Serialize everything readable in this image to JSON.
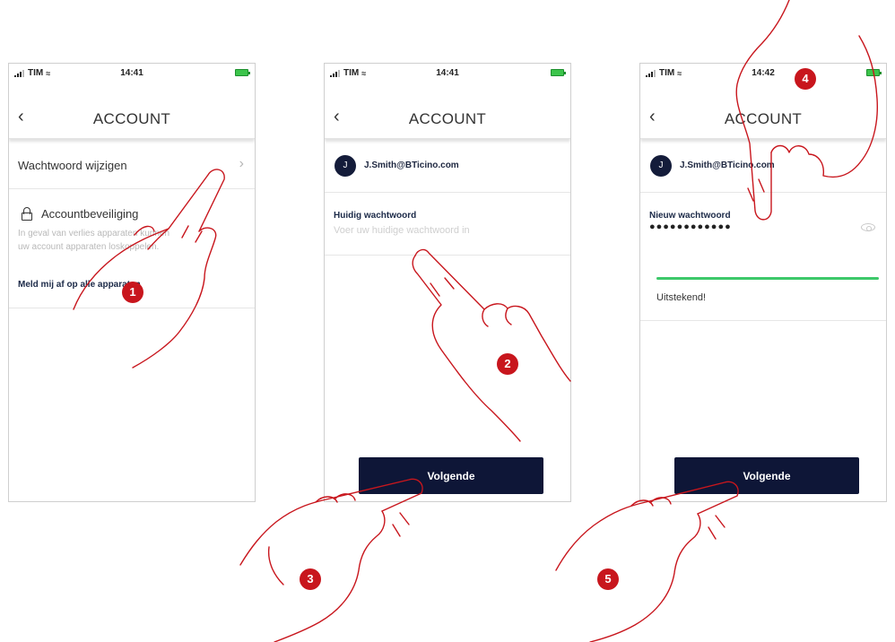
{
  "status_bar": {
    "carrier": "TIM",
    "time_screen1": "14:41",
    "time_screen2": "14:41",
    "time_screen3": "14:42"
  },
  "nav": {
    "title": "ACCOUNT",
    "back_glyph": "‹"
  },
  "screen1": {
    "change_password_label": "Wachtwoord wijzigen",
    "chevron_glyph": "›",
    "security_title": "Accountbeveiliging",
    "security_desc": "In geval van verlies apparaten kunnen uw account apparaten loskoppelen.",
    "logout_all_label": "Meld mij af op alle apparaten"
  },
  "screen2": {
    "avatar_initial": "J",
    "email": "J.Smith@BTicino.com",
    "field_label": "Huidig wachtwoord",
    "field_placeholder": "Voer uw huidige wachtwoord in",
    "next_label": "Volgende"
  },
  "screen3": {
    "avatar_initial": "J",
    "email": "J.Smith@BTicino.com",
    "field_label": "Nieuw wachtwoord",
    "field_value": "●●●●●●●●●●●●",
    "strength_label": "Uitstekend!",
    "next_label": "Volgende"
  },
  "markers": [
    "1",
    "2",
    "3",
    "4",
    "5"
  ],
  "colors": {
    "marker": "#c8161d",
    "button": "#0e1637",
    "strength": "#3dc86a",
    "hand_stroke": "#c8161d"
  },
  "icons": [
    "back-chevron-icon",
    "chevron-right-icon",
    "lock-icon",
    "eye-icon",
    "signal-icon",
    "wifi-icon",
    "battery-icon",
    "hand-pointer-icon"
  ]
}
